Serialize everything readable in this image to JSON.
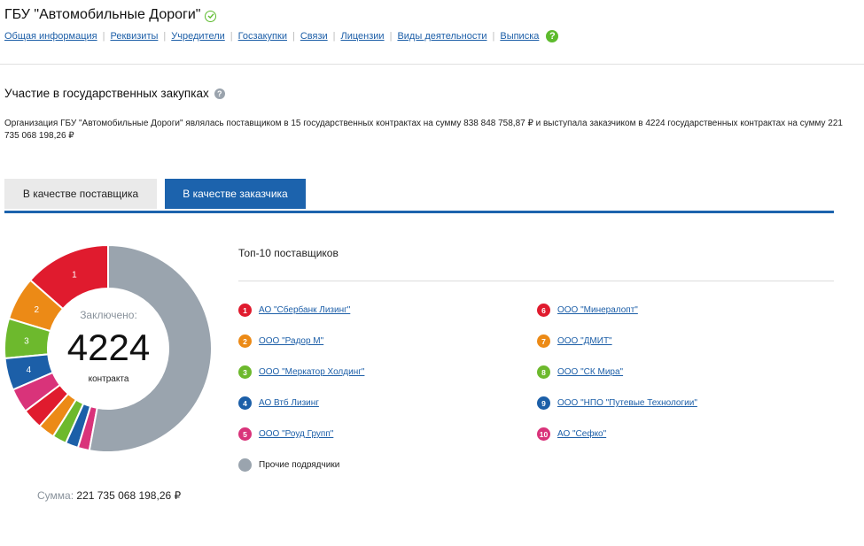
{
  "header": {
    "title": "ГБУ \"Автомобильные Дороги\"",
    "nav": [
      "Общая информация",
      "Реквизиты",
      "Учредители",
      "Госзакупки",
      "Связи",
      "Лицензии",
      "Виды деятельности",
      "Выписка"
    ],
    "help_glyph": "?"
  },
  "section": {
    "title": "Участие в государственных закупках",
    "help_glyph": "?",
    "description": "Организация ГБУ \"Автомобильные Дороги\" являлась поставщиком в 15 государственных контрактах на сумму 838 848 758,87 ₽ и выступала заказчиком в 4224 государственных контрактах на сумму 221 735 068 198,26 ₽"
  },
  "tabs": {
    "supplier": "В качестве поставщика",
    "customer": "В качестве заказчика",
    "active": "customer"
  },
  "donut": {
    "center_label": "Заключено:",
    "center_value": "4224",
    "center_unit": "контракта",
    "sum_label": "Сумма:",
    "sum_value": "221 735 068 198,26 ₽"
  },
  "top10": {
    "title": "Топ-10 поставщиков",
    "others_label": "Прочие подрядчики"
  },
  "chart_data": {
    "type": "pie",
    "title": "Топ-10 поставщиков",
    "slices": [
      {
        "rank": "1",
        "name": "АО \"Сбербанк Лизинг\"",
        "value": 13.5,
        "color": "#e01b2e"
      },
      {
        "rank": "2",
        "name": "ООО \"Радор М\"",
        "value": 6.8,
        "color": "#ec8a16"
      },
      {
        "rank": "3",
        "name": "ООО \"Меркатор Холдинг\"",
        "value": 6.2,
        "color": "#6db92d"
      },
      {
        "rank": "4",
        "name": "АО Втб Лизинг",
        "value": 5.0,
        "color": "#1c5fa8"
      },
      {
        "rank": "5",
        "name": "ООО \"Роуд Групп\"",
        "value": 3.8,
        "color": "#d9337a"
      },
      {
        "rank": "6",
        "name": "ООО \"Минералопт\"",
        "value": 3.2,
        "color": "#e01b2e"
      },
      {
        "rank": "7",
        "name": "ООО \"ДМИТ\"",
        "value": 2.6,
        "color": "#ec8a16"
      },
      {
        "rank": "8",
        "name": "ООО \"СК Мира\"",
        "value": 2.2,
        "color": "#6db92d"
      },
      {
        "rank": "9",
        "name": "ООО \"НПО \"Путевые Технологии\"",
        "value": 2.0,
        "color": "#1c5fa8"
      },
      {
        "rank": "10",
        "name": "АО \"Сефко\"",
        "value": 1.8,
        "color": "#d9337a"
      },
      {
        "rank": "",
        "name": "Прочие подрядчики",
        "value": 52.9,
        "color": "#9aa4ae"
      }
    ],
    "slice_labels_shown": [
      "1",
      "2",
      "3",
      "4"
    ]
  }
}
